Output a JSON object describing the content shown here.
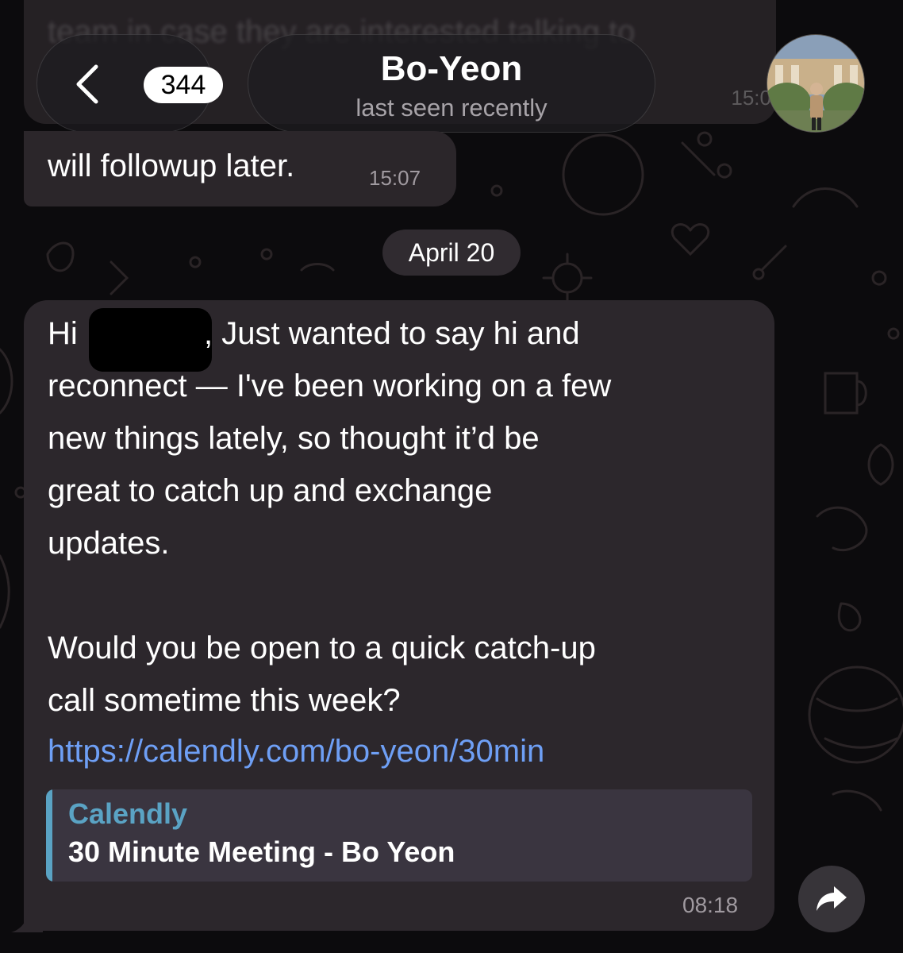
{
  "header": {
    "unread_count": "344",
    "contact_name": "Bo-Yeon",
    "contact_status": "last seen recently"
  },
  "faded_message": {
    "text": "team in case they are interested talking to",
    "time": "15:0"
  },
  "previous_message": {
    "text": "will followup later.",
    "time": "15:07"
  },
  "date_separator": "April 20",
  "message": {
    "lines": [
      "Hi ",
      ", Just wanted to say hi and",
      "reconnect — I've been working on a few",
      "new things lately, so thought it’d be",
      "great to catch up and exchange",
      "updates.",
      "Would you be open to a quick catch-up",
      "call sometime this week?"
    ],
    "link": "https://calendly.com/bo-yeon/30min",
    "preview": {
      "site": "Calendly",
      "title": "30 Minute Meeting - Bo Yeon"
    },
    "time": "08:18"
  },
  "colors": {
    "background": "#0c0b0d",
    "bubble": "#2c272c",
    "link": "#6e9ff5",
    "preview_accent": "#5aa3c4"
  },
  "icons": [
    "back-chevron-icon",
    "forward-share-icon",
    "doodle-pattern-icon"
  ]
}
